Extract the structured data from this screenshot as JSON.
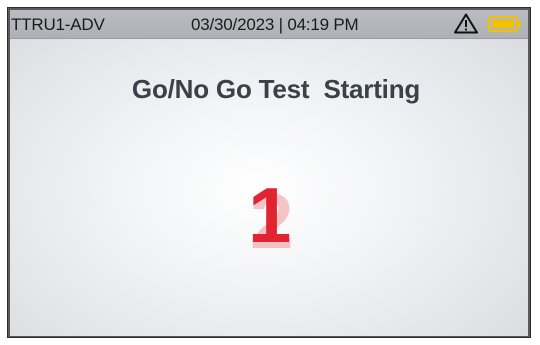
{
  "status_bar": {
    "device_name": "TTRU1-ADV",
    "datetime": "03/30/2023 | 04:19 PM",
    "warning_icon": "warning-triangle-icon",
    "battery_icon": "battery-icon",
    "battery_color": "#f2c100"
  },
  "main": {
    "title": "Go/No Go Test  Starting",
    "countdown_current": "1",
    "countdown_next": "2",
    "countdown_color": "#e02430"
  }
}
